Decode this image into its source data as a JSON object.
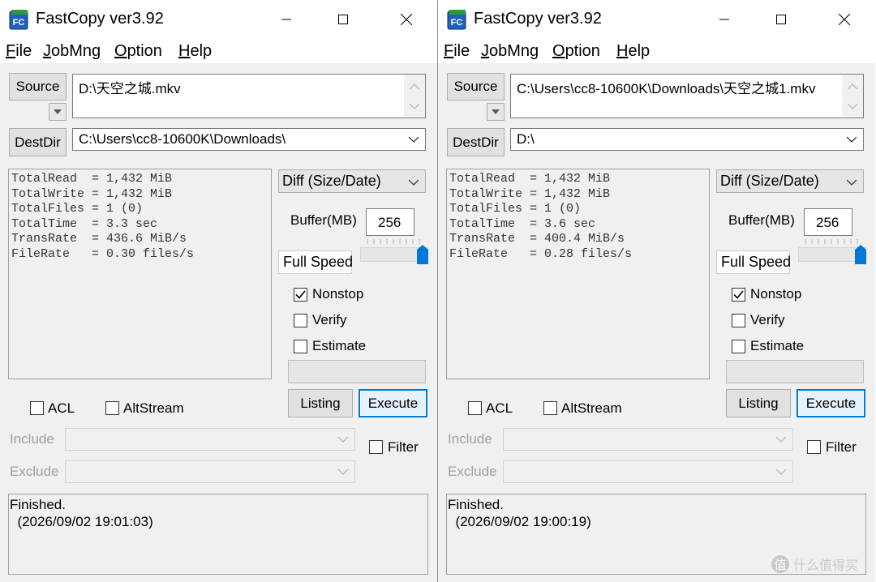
{
  "windows": [
    {
      "title": "FastCopy ver3.92",
      "menu": [
        "File",
        "JobMng",
        "Option",
        "Help"
      ],
      "source_label": "Source",
      "source_path": "D:\\天空之城.mkv",
      "destdir_label": "DestDir",
      "dest_path": "C:\\Users\\cc8-10600K\\Downloads\\",
      "stats": [
        "TotalRead  = 1,432 MiB",
        "TotalWrite = 1,432 MiB",
        "TotalFiles = 1 (0)",
        "TotalTime  = 3.3 sec",
        "TransRate  = 436.6 MiB/s",
        "FileRate   = 0.30 files/s"
      ],
      "mode": "Diff (Size/Date)",
      "buffer_label": "Buffer(MB)",
      "buffer_value": "256",
      "speed_label": "Full Speed",
      "speed_level": 1.0,
      "options": [
        {
          "label": "Nonstop",
          "checked": true
        },
        {
          "label": "Verify",
          "checked": false
        },
        {
          "label": "Estimate",
          "checked": false
        }
      ],
      "listing_label": "Listing",
      "execute_label": "Execute",
      "acl_label": "ACL",
      "altstream_label": "AltStream",
      "include_label": "Include",
      "exclude_label": "Exclude",
      "filter_label": "Filter",
      "status_lines": [
        "Finished.",
        "  (2026/09/02 19:01:03)"
      ]
    },
    {
      "title": "FastCopy ver3.92",
      "menu": [
        "File",
        "JobMng",
        "Option",
        "Help"
      ],
      "source_label": "Source",
      "source_path": "C:\\Users\\cc8-10600K\\Downloads\\天空之城1.mkv",
      "destdir_label": "DestDir",
      "dest_path": "D:\\",
      "stats": [
        "TotalRead  = 1,432 MiB",
        "TotalWrite = 1,432 MiB",
        "TotalFiles = 1 (0)",
        "TotalTime  = 3.6 sec",
        "TransRate  = 400.4 MiB/s",
        "FileRate   = 0.28 files/s"
      ],
      "mode": "Diff (Size/Date)",
      "buffer_label": "Buffer(MB)",
      "buffer_value": "256",
      "speed_label": "Full Speed",
      "speed_level": 1.0,
      "options": [
        {
          "label": "Nonstop",
          "checked": true
        },
        {
          "label": "Verify",
          "checked": false
        },
        {
          "label": "Estimate",
          "checked": false
        }
      ],
      "listing_label": "Listing",
      "execute_label": "Execute",
      "acl_label": "ACL",
      "altstream_label": "AltStream",
      "include_label": "Include",
      "exclude_label": "Exclude",
      "filter_label": "Filter",
      "status_lines": [
        "Finished.",
        "  (2026/09/02 19:00:19)"
      ]
    }
  ],
  "watermark": {
    "icon_text": "值",
    "text": "什么值得买"
  },
  "colors": {
    "accent": "#0078d7",
    "slider_thumb": "#0078d7",
    "icon_blue": "#1f5fbf",
    "icon_green": "#2a9d3a"
  }
}
